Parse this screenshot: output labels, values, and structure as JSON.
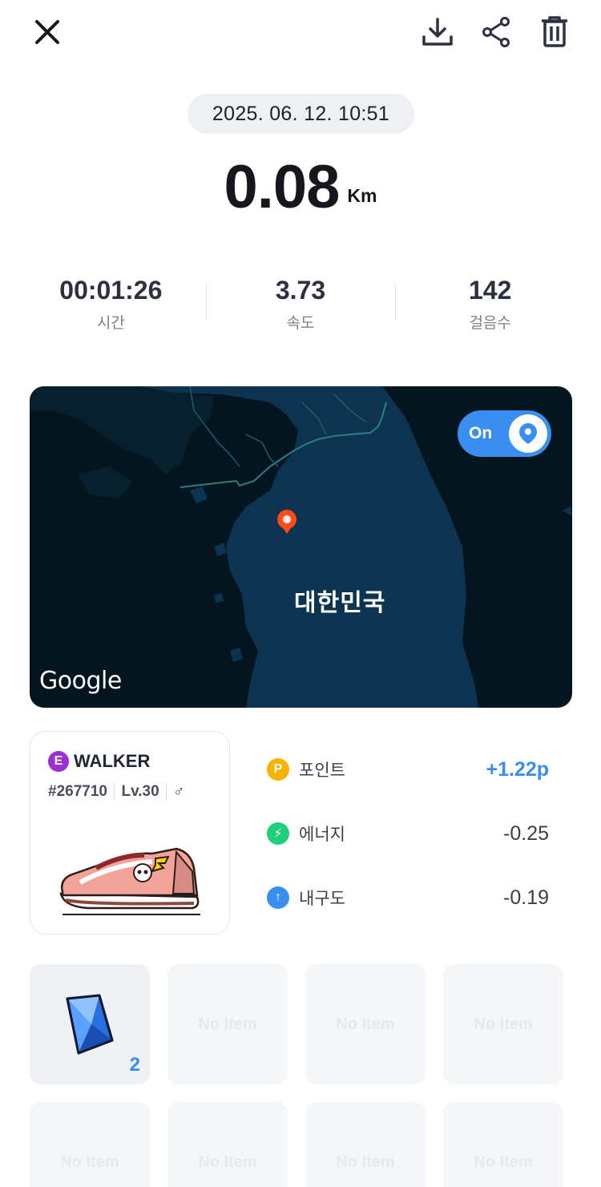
{
  "toolbar": {
    "close_icon": "close-icon",
    "download_icon": "download-icon",
    "share_icon": "share-icon",
    "delete_icon": "trash-icon"
  },
  "record": {
    "datetime": "2025. 06. 12. 10:51",
    "distance": "0.08",
    "distance_unit": "Km"
  },
  "stats": [
    {
      "value": "00:01:26",
      "label": "시간"
    },
    {
      "value": "3.73",
      "label": "속도"
    },
    {
      "value": "142",
      "label": "걸음수"
    }
  ],
  "map": {
    "region_label": "대한민국",
    "provider": "Google",
    "toggle_label": "On",
    "toggle_on": true,
    "pin_color": "#ff4a1a"
  },
  "walker": {
    "grade_badge": "E",
    "name": "WALKER",
    "id": "#267710",
    "level": "Lv.30",
    "gender_symbol": "♂"
  },
  "rewards": [
    {
      "icon_text": "P",
      "icon": "point-icon",
      "color": "#f5b400",
      "label": "포인트",
      "value": "+1.22p",
      "positive": true
    },
    {
      "icon_text": "⚡",
      "icon": "energy-icon",
      "color": "#1fcf7a",
      "label": "에너지",
      "value": "-0.25",
      "positive": false
    },
    {
      "icon_text": "↑",
      "icon": "durability-icon",
      "color": "#3a8ef0",
      "label": "내구도",
      "value": "-0.19",
      "positive": false
    }
  ],
  "items": {
    "empty_label": "No Item",
    "slots": [
      {
        "filled": true,
        "icon": "crystal-icon",
        "count": "2"
      },
      {
        "filled": false
      },
      {
        "filled": false
      },
      {
        "filled": false
      },
      {
        "filled": false
      },
      {
        "filled": false
      },
      {
        "filled": false
      },
      {
        "filled": false
      }
    ]
  },
  "colors": {
    "accent": "#3a8ef0",
    "map_background": "#04151f",
    "map_land": "#0c3350"
  }
}
